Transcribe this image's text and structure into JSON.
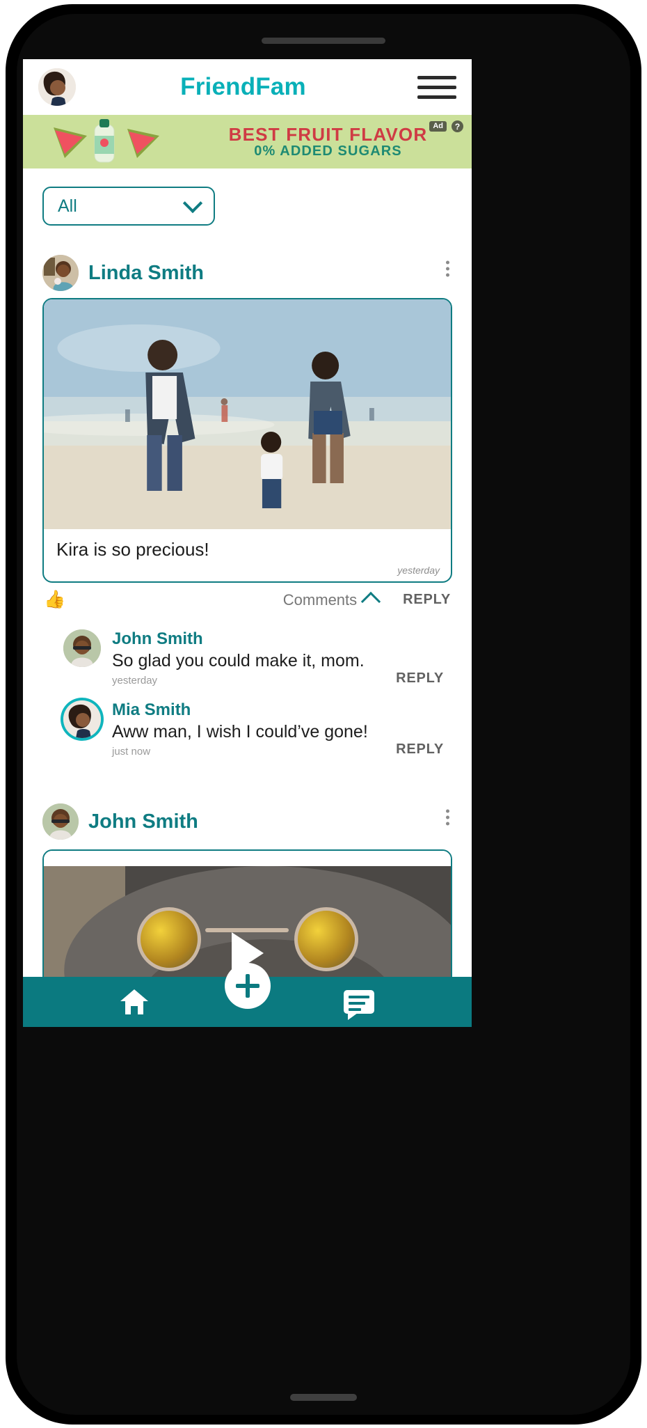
{
  "app": {
    "title": "FriendFam",
    "brand_color": "#09b0b8",
    "accent_color": "#0f7c82",
    "nav_color": "#0b7a80",
    "menu_icon": "hamburger-menu-icon",
    "avatar_icon": "user-avatar"
  },
  "ad": {
    "headline": "BEST FRUIT FLAVOR",
    "subline": "0% ADDED SUGARS",
    "badge": "Ad",
    "help": "?",
    "bg_color": "#cbe09a",
    "headline_color": "#cf3b44",
    "subline_color": "#1e8a73"
  },
  "filter": {
    "value": "All",
    "icon": "chevron-down-icon"
  },
  "posts": [
    {
      "author": "Linda Smith",
      "caption": "Kira is so precious!",
      "time": "yesterday",
      "like_icon": "thumbs-up-icon",
      "comments_label": "Comments",
      "comments_icon": "chevron-up-icon",
      "reply_label": "REPLY",
      "menu_icon": "more-options-icon",
      "media_type": "photo",
      "comments": [
        {
          "author": "John Smith",
          "text": "So glad you could make it, mom.",
          "time": "yesterday",
          "reply_label": "REPLY",
          "highlighted": "false"
        },
        {
          "author": "Mia Smith",
          "text": "Aww man, I wish I could’ve gone!",
          "time": "just now",
          "reply_label": "REPLY",
          "highlighted": "true"
        }
      ]
    },
    {
      "author": "John Smith",
      "caption": "",
      "time": "",
      "menu_icon": "more-options-icon",
      "media_type": "video",
      "play_icon": "play-button-icon",
      "comments": []
    }
  ],
  "bottom_nav": {
    "items": [
      {
        "name": "home",
        "icon": "home-icon"
      },
      {
        "name": "create",
        "icon": "plus-icon"
      },
      {
        "name": "messages",
        "icon": "chat-icon"
      }
    ]
  }
}
